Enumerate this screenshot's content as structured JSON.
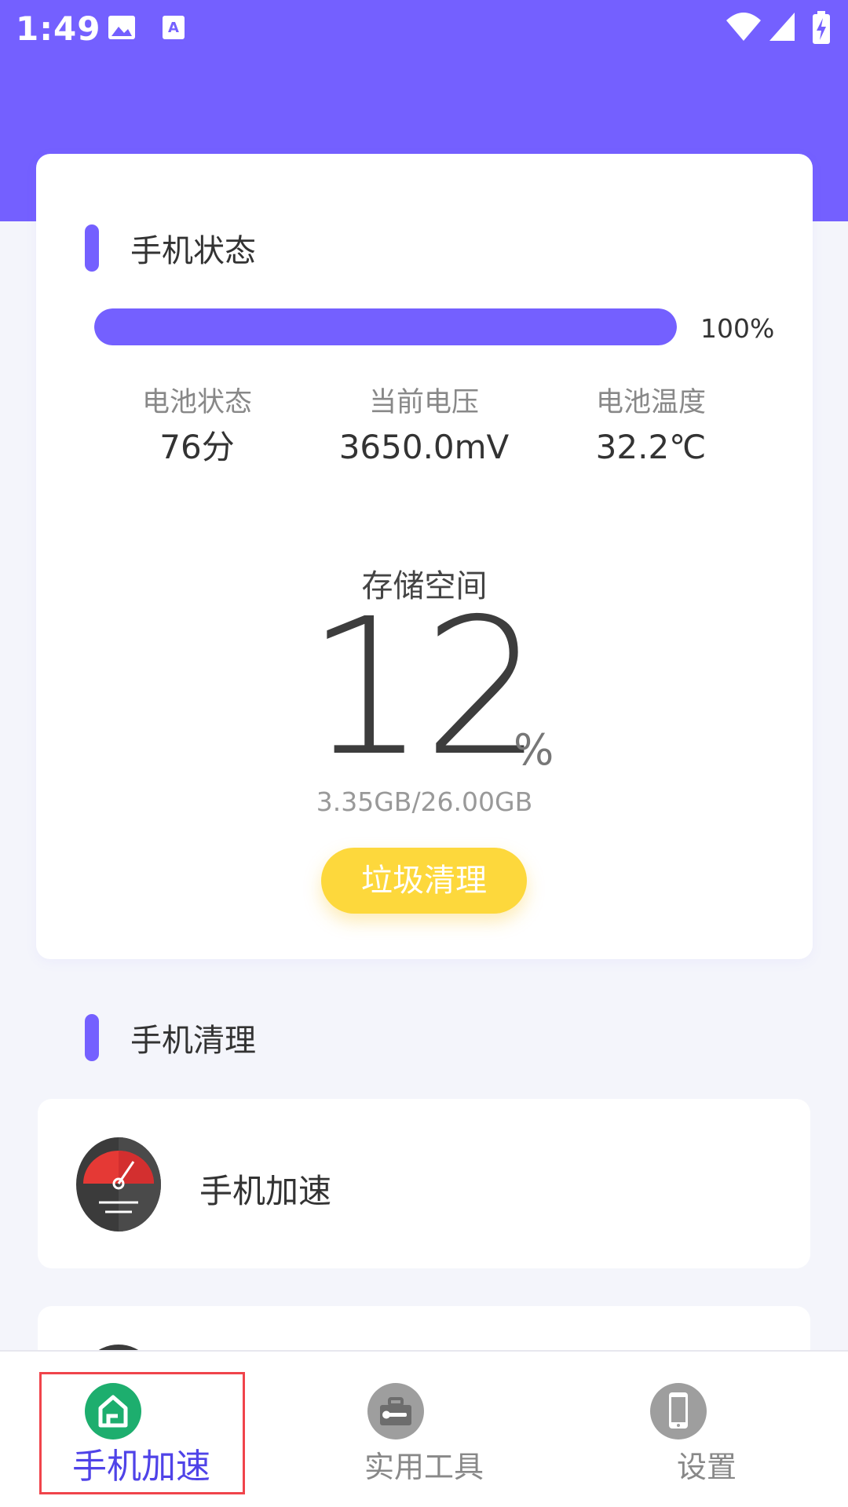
{
  "status_bar": {
    "time": "1:49"
  },
  "status_card": {
    "title": "手机状态",
    "progress": {
      "fraction": 1.0,
      "label": "100%"
    },
    "stats": [
      {
        "label": "电池状态",
        "value": "76分"
      },
      {
        "label": "当前电压",
        "value": "3650.0mV"
      },
      {
        "label": "电池温度",
        "value": "32.2℃"
      }
    ],
    "storage": {
      "label": "存储空间",
      "percent": "12",
      "unit": "%",
      "detail": "3.35GB/26.00GB"
    },
    "clean_button": "垃圾清理"
  },
  "cleaning": {
    "title": "手机清理",
    "items": [
      {
        "label": "手机加速"
      }
    ]
  },
  "bottom_nav": {
    "items": [
      {
        "label": "手机加速",
        "icon": "home-icon",
        "active": true
      },
      {
        "label": "实用工具",
        "icon": "toolbox-icon",
        "active": false
      },
      {
        "label": "设置",
        "icon": "phone-icon",
        "active": false
      }
    ]
  },
  "colors": {
    "primary": "#7460FF",
    "button": "#FDD83C",
    "active_nav": "#4F43E8",
    "highlight": "#F0444B"
  }
}
